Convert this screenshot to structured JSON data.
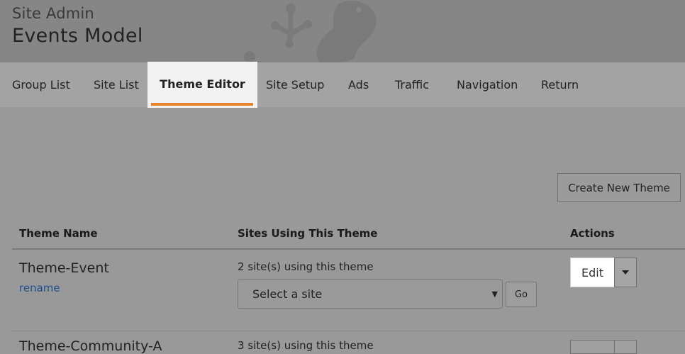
{
  "header": {
    "admin_label": "Site Admin",
    "site_name": "Events Model",
    "logo_icon": "frog-logo-icon"
  },
  "nav": {
    "items": [
      {
        "label": "Group List",
        "active": false
      },
      {
        "label": "Site List",
        "active": false
      },
      {
        "label": "Theme Editor",
        "active": true
      },
      {
        "label": "Site Setup",
        "active": false
      },
      {
        "label": "Ads",
        "active": false
      },
      {
        "label": "Traffic",
        "active": false
      },
      {
        "label": "Navigation",
        "active": false
      },
      {
        "label": "Return",
        "active": false
      }
    ],
    "active_color": "#e8822a"
  },
  "toolbar": {
    "create_label": "Create New Theme"
  },
  "table": {
    "columns": [
      "Theme Name",
      "Sites Using This Theme",
      "Actions"
    ],
    "rows": [
      {
        "name": "Theme-Event",
        "rename_label": "rename",
        "sites_text": "2 site(s) using this theme",
        "select_placeholder": "Select a site",
        "go_label": "Go",
        "edit_label": "Edit"
      },
      {
        "name": "Theme-Community-A",
        "sites_text": "3 site(s) using this theme"
      }
    ]
  }
}
